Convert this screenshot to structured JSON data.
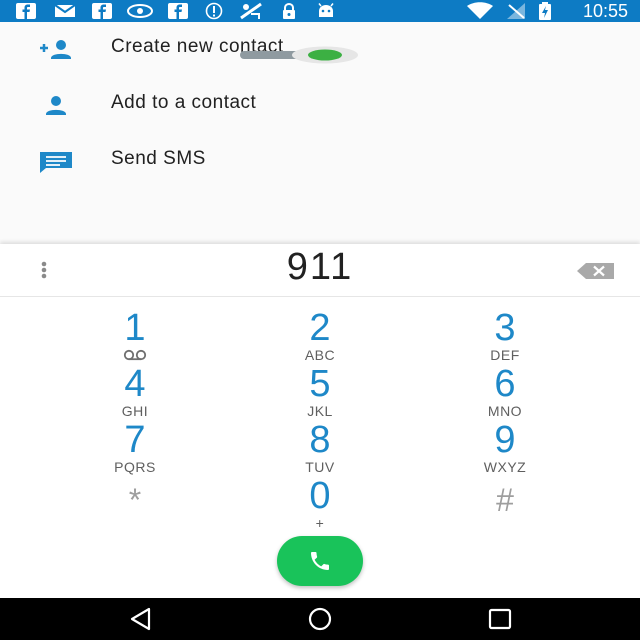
{
  "status_bar": {
    "time": "10:55",
    "left_icons": [
      "facebook-icon",
      "mail-icon",
      "facebook-icon",
      "eye-icon",
      "facebook-icon",
      "info-icon",
      "no-signal-icon",
      "lock-icon",
      "android-icon"
    ],
    "right_icons": [
      "wifi-icon",
      "no-sim-icon",
      "battery-charging-icon"
    ],
    "background_color": "#0d7bc4"
  },
  "actions": [
    {
      "label": "Create new contact",
      "icon": "add-person-icon"
    },
    {
      "label": "Add to a contact",
      "icon": "person-icon"
    },
    {
      "label": "Send SMS",
      "icon": "message-icon"
    }
  ],
  "dialpad": {
    "entered_number": "911",
    "keys": [
      {
        "digit": "1",
        "letters": "",
        "sub_icon": "voicemail-icon"
      },
      {
        "digit": "2",
        "letters": "ABC"
      },
      {
        "digit": "3",
        "letters": "DEF"
      },
      {
        "digit": "4",
        "letters": "GHI"
      },
      {
        "digit": "5",
        "letters": "JKL"
      },
      {
        "digit": "6",
        "letters": "MNO"
      },
      {
        "digit": "7",
        "letters": "PQRS"
      },
      {
        "digit": "8",
        "letters": "TUV"
      },
      {
        "digit": "9",
        "letters": "WXYZ"
      },
      {
        "digit": "*",
        "letters": ""
      },
      {
        "digit": "0",
        "letters": "+"
      },
      {
        "digit": "#",
        "letters": ""
      }
    ],
    "accent_color": "#1e88c8",
    "call_button_color": "#19c35a"
  },
  "nav_bar": {
    "buttons": [
      "back-icon",
      "home-icon",
      "recents-icon"
    ]
  }
}
